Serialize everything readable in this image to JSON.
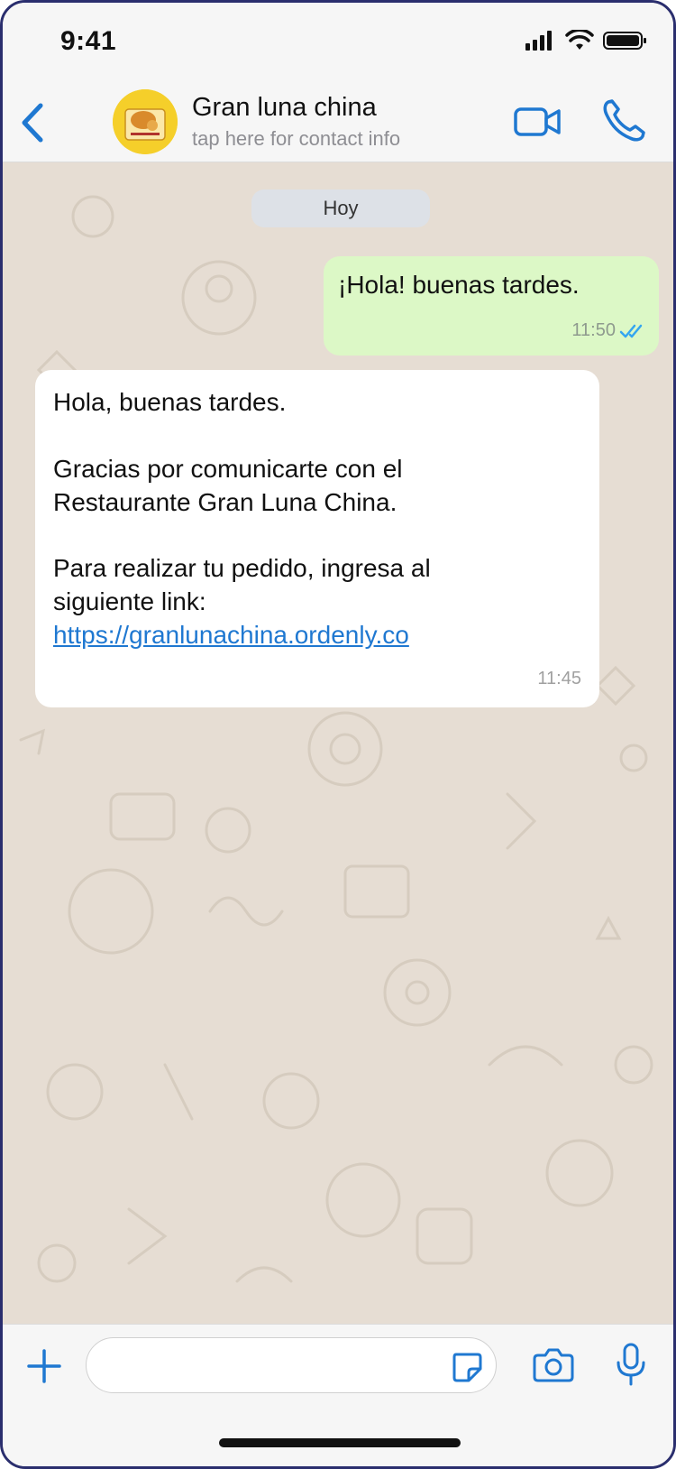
{
  "status_bar": {
    "time": "9:41"
  },
  "header": {
    "contact_name": "Gran luna china",
    "contact_subtitle": "tap here for contact info"
  },
  "chat": {
    "date_label": "Hoy",
    "messages": [
      {
        "direction": "outgoing",
        "text": "¡Hola! buenas tardes.",
        "time": "11:50",
        "status": "read"
      },
      {
        "direction": "incoming",
        "lines": [
          "Hola, buenas tardes.",
          "Gracias por comunicarte con el",
          "Restaurante Gran Luna China.",
          "Para realizar tu pedido, ingresa al",
          "siguiente link:"
        ],
        "link": "https://granlunachina.ordenly.co",
        "time": "11:45"
      }
    ]
  },
  "icons": {
    "back": "chevron-left-icon",
    "video": "video-camera-icon",
    "call": "phone-icon",
    "plus": "plus-icon",
    "sticker": "sticker-icon",
    "camera": "camera-icon",
    "mic": "microphone-icon"
  },
  "colors": {
    "accent": "#1f78d1",
    "outgoing_bubble": "#dcf8c6",
    "incoming_bubble": "#ffffff",
    "chat_background": "#e6ddd3"
  }
}
